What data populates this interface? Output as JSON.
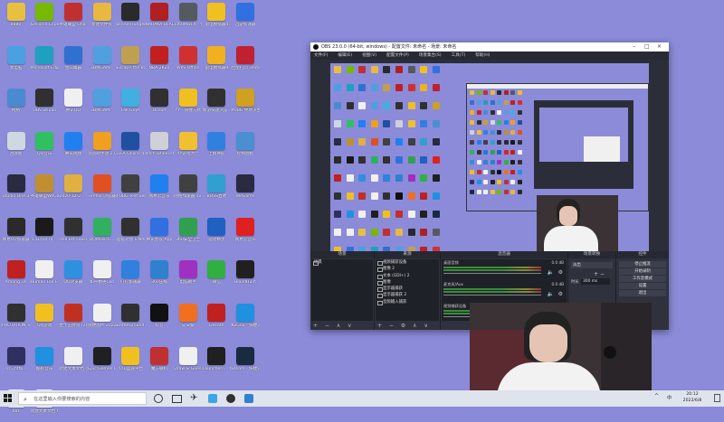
{
  "desktop": {
    "icons": [
      {
        "label": "8880",
        "color": "#e8c040"
      },
      {
        "label": "GeForce Experience",
        "color": "#76b900"
      },
      {
        "label": "英雄联盟 Online",
        "color": "#c03030"
      },
      {
        "label": "新建文件夹",
        "color": "#e8b840"
      },
      {
        "label": "Dread Hunger",
        "color": "#2a2a2a"
      },
      {
        "label": "NARAKA BLADEPOI...",
        "color": "#b02020"
      },
      {
        "label": "TotalMixFX - 快捷方式",
        "color": "#555a60"
      },
      {
        "label": "雷电模拟器4",
        "color": "#f0c020"
      },
      {
        "label": "迅游加速器",
        "color": "#3070e0"
      },
      {
        "label": "此电脑",
        "color": "#4aa0e0"
      },
      {
        "label": "Microsoft Edge",
        "color": "#1ea0c0"
      },
      {
        "label": "金山毒霸",
        "color": "#3070d0"
      },
      {
        "label": "3DMGAM...",
        "color": "#50a0e0"
      },
      {
        "label": "Escape the Backrooms",
        "color": "#c0a050"
      },
      {
        "label": "NBA 2K20",
        "color": "#c02020"
      },
      {
        "label": "WPS Office",
        "color": "#d03030"
      },
      {
        "label": "雷电模拟器9",
        "color": "#f0b020"
      },
      {
        "label": "佳能打印 Demo",
        "color": "#c02030"
      },
      {
        "label": "网络",
        "color": "#4a8ad0"
      },
      {
        "label": "OBS Studio",
        "color": "#303030"
      },
      {
        "label": "腾讯QQ",
        "color": "#f0f0f0"
      },
      {
        "label": "3DMGAM...",
        "color": "#50a0e0"
      },
      {
        "label": "Fall Guys",
        "color": "#40b0e0"
      },
      {
        "label": "Occult",
        "color": "#303030"
      },
      {
        "label": "YY - 快捷方式",
        "color": "#f0c020"
      },
      {
        "label": "新游快速浏览...",
        "color": "#303030"
      },
      {
        "label": "PUBG 绝地求生",
        "color": "#d0a020"
      },
      {
        "label": "回收站",
        "color": "#cfd8e0"
      },
      {
        "label": "QQ音乐",
        "color": "#30c060"
      },
      {
        "label": "腾讯视频",
        "color": "#2080f0"
      },
      {
        "label": "现货助手动 2.0",
        "color": "#f0a020"
      },
      {
        "label": "FIFA Online 4",
        "color": "#2050a0"
      },
      {
        "label": "Pitch wheel.sfl",
        "color": "#cfd0d8"
      },
      {
        "label": "YY游戏大厅",
        "color": "#f0c030"
      },
      {
        "label": "上网导航",
        "color": "#3080e0"
      },
      {
        "label": "控制面板",
        "color": "#4a90d0"
      },
      {
        "label": "Studio One 3",
        "color": "#2a2a40"
      },
      {
        "label": "英雄联盟WeGame 平台",
        "color": "#c09030"
      },
      {
        "label": "2020-12-2... - 快捷方式",
        "color": "#e0b040"
      },
      {
        "label": "Firefox 浏览器",
        "color": "#e05020"
      },
      {
        "label": "PUBG Test Server",
        "color": "#404040"
      },
      {
        "label": "网易云音乐",
        "color": "#2080f0"
      },
      {
        "label": "网络加速器 1v5000...",
        "color": "#404040"
      },
      {
        "label": "BOSS直聘",
        "color": "#30a0d0"
      },
      {
        "label": "WeGame",
        "color": "#2a2a40"
      },
      {
        "label": "网易UU加速器",
        "color": "#2a2a2a"
      },
      {
        "label": "14141474...",
        "color": "#1a1a1a"
      },
      {
        "label": "Hell Let Loose",
        "color": "#303030"
      },
      {
        "label": "QQMusicC...",
        "color": "#30b060"
      },
      {
        "label": "超级对接 FINAL BETA",
        "color": "#303030"
      },
      {
        "label": "腾讯会议 App",
        "color": "#3070e0"
      },
      {
        "label": "360安全卫士",
        "color": "#30a050"
      },
      {
        "label": "驱动精灵",
        "color": "#2060c0"
      },
      {
        "label": "网易云音乐",
        "color": "#e02020"
      },
      {
        "label": "Among Us",
        "color": "#c02020"
      },
      {
        "label": "Human Fall Flat",
        "color": "#f0f0f0"
      },
      {
        "label": "QQ浏览器",
        "color": "#3090e0"
      },
      {
        "label": "和平精英Cko",
        "color": "#f0f0f0"
      },
      {
        "label": "钉钉加速器",
        "color": "#3080e0"
      },
      {
        "label": "360压缩",
        "color": "#3080d0"
      },
      {
        "label": "电脑助手",
        "color": "#a030c0"
      },
      {
        "label": "微信",
        "color": "#30b040"
      },
      {
        "label": "BloodHunt",
        "color": "#202020"
      },
      {
        "label": "PHOTATION To FEAR",
        "color": "#303030"
      },
      {
        "label": "QQ游戏",
        "color": "#f0c020"
      },
      {
        "label": "金卡王牌游 (2)",
        "color": "#c03020"
      },
      {
        "label": "随便图片 2022...",
        "color": "#f0f0f0"
      },
      {
        "label": "BattleGrounds Games L...",
        "color": "#303030"
      },
      {
        "label": "抖音",
        "color": "#111111"
      },
      {
        "label": "向日葵",
        "color": "#f07020"
      },
      {
        "label": "Decath",
        "color": "#c02020"
      },
      {
        "label": "KuGou - 快捷方式",
        "color": "#2090e0"
      },
      {
        "label": "src=http...",
        "color": "#303060"
      },
      {
        "label": "酷狗音乐",
        "color": "#2090e0"
      },
      {
        "label": "新建文本文档 (3).txt",
        "color": "#f0f0f0"
      },
      {
        "label": "Epic Games Launcher",
        "color": "#202020"
      },
      {
        "label": "火山盟速平台",
        "color": "#f0c020"
      },
      {
        "label": "魔方联机",
        "color": "#c03030"
      },
      {
        "label": "Draw & Guess",
        "color": "#f0f0f0"
      },
      {
        "label": "Launcher... - 快捷方式",
        "color": "#202020"
      },
      {
        "label": "Steam - 快捷方式",
        "color": "#1a2a40"
      },
      {
        "label": "bat",
        "color": "#f0f0f0"
      },
      {
        "label": "新建文本文档.txt",
        "color": "#f0f0f0"
      }
    ]
  },
  "obs": {
    "title": "OBS 23.0.0 (64-bit, windows) - 配置文件: 未命名 - 场景: 未命名",
    "menu": [
      "文件(F)",
      "编辑(E)",
      "视图(V)",
      "配置文件(P)",
      "场景集合(S)",
      "工具(T)",
      "帮助(H)"
    ],
    "docks": {
      "scenes": {
        "title": "场景",
        "items": [
          "场景"
        ]
      },
      "sources": {
        "title": "来源",
        "items": [
          "视频捕获设备",
          "图像 2",
          "文本 (GDI+) 2",
          "图像",
          "显示器捕获",
          "显示器捕获 2",
          "音频输入捕获"
        ]
      },
      "mixer": {
        "title": "混音器",
        "channels": [
          {
            "name": "桌面音频",
            "db": "0.0 dB"
          },
          {
            "name": "麦克风/Aux",
            "db": "0.0 dB"
          },
          {
            "name": "视频捕获设备",
            "db": "0.0 dB"
          }
        ]
      },
      "transitions": {
        "title": "场景转换",
        "type": "淡出",
        "duration_label": "时长",
        "duration": "300 ms"
      },
      "controls": {
        "title": "控件",
        "buttons": [
          "停止推流",
          "开始录制",
          "工作室模式",
          "设置",
          "退出"
        ]
      }
    }
  },
  "taskbar": {
    "search_placeholder": "在这里输入你要搜索的内容",
    "time": "20:12",
    "date": "2022/6/8",
    "tray_lang": "中"
  }
}
